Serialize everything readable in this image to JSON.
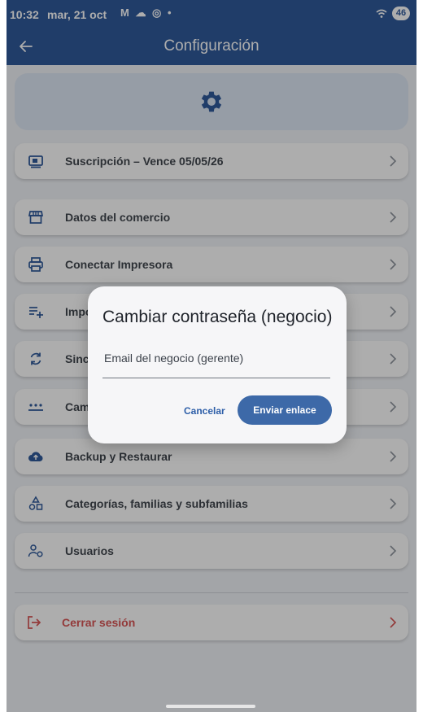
{
  "status_bar": {
    "time": "10:32",
    "date": "mar, 21 oct",
    "notification_icons": "M ☁ ◎ •",
    "battery": "46"
  },
  "app_bar": {
    "title": "Configuración",
    "back_icon": "arrow-left-icon"
  },
  "header_card": {
    "icon": "gear-icon"
  },
  "menu_items": [
    {
      "label": "Suscripción – Vence 05/05/26",
      "icon": "subscription-icon"
    },
    {
      "label": "Datos del comercio",
      "icon": "store-icon"
    },
    {
      "label": "Conectar Impresora",
      "icon": "printer-icon"
    },
    {
      "label": "Importar",
      "icon": "import-list-icon"
    },
    {
      "label": "Sincronizar",
      "icon": "sync-icon"
    },
    {
      "label": "Cambiar contraseña",
      "icon": "password-icon"
    },
    {
      "label": "Backup y Restaurar",
      "icon": "cloud-upload-icon"
    },
    {
      "label": "Categorías, familias y subfamilias",
      "icon": "categories-icon"
    },
    {
      "label": "Usuarios",
      "icon": "users-icon"
    }
  ],
  "logout": {
    "label": "Cerrar sesión",
    "icon": "logout-icon"
  },
  "dialog": {
    "title": "Cambiar contraseña (negocio)",
    "email_placeholder": "Email del negocio (gerente)",
    "cancel_label": "Cancelar",
    "send_label": "Enviar enlace"
  },
  "colors": {
    "primary": "#0d3e8a",
    "button": "#3d69a8",
    "danger": "#d23a3a",
    "background": "#eef1f6"
  }
}
